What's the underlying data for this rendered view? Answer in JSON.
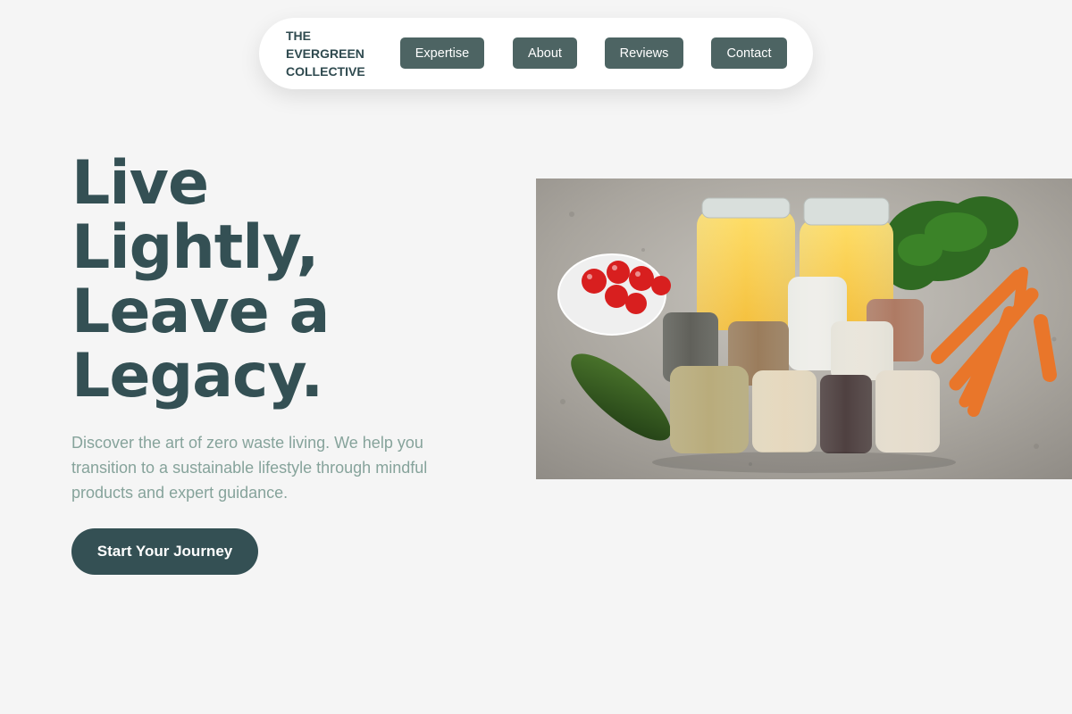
{
  "nav": {
    "brand_lines": [
      "THE",
      "EVERGREEN",
      "COLLECTIVE"
    ],
    "items": [
      {
        "label": "Expertise"
      },
      {
        "label": "About"
      },
      {
        "label": "Reviews"
      },
      {
        "label": "Contact"
      }
    ]
  },
  "hero": {
    "title_lines": [
      "Live",
      "Lightly,",
      "Leave a",
      "Legacy."
    ],
    "description": "Discover the art of zero waste living. We help you transition to a sustainable lifestyle through mindful products and expert guidance.",
    "cta_label": "Start Your Journey"
  },
  "image": {
    "subject": "glass jars of pasta, nuts and grains with tomatoes, zucchini and carrots on stone"
  },
  "colors": {
    "background": "#f5f5f5",
    "primary": "#345054",
    "nav_button": "#4d6463",
    "muted_text": "#86a39b"
  }
}
